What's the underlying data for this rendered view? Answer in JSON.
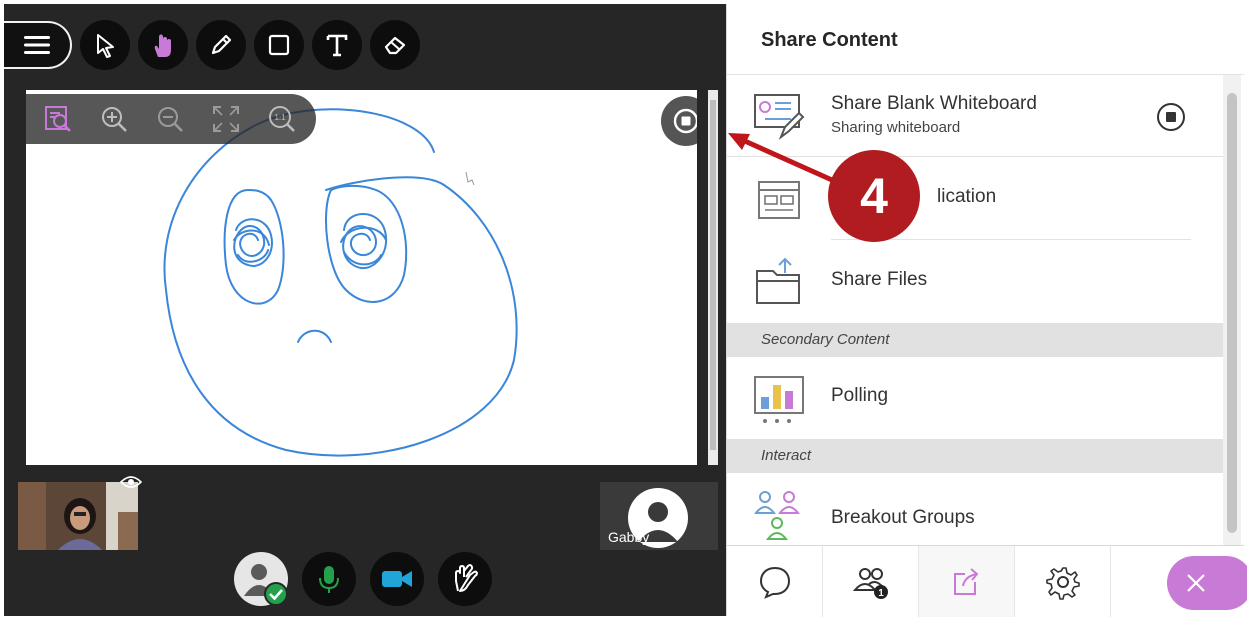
{
  "toolbar": {
    "tools": [
      {
        "name": "select-arrow-icon"
      },
      {
        "name": "pan-hand-icon",
        "active": true
      },
      {
        "name": "pencil-icon"
      },
      {
        "name": "rectangle-icon"
      },
      {
        "name": "text-icon"
      },
      {
        "name": "eraser-icon"
      }
    ]
  },
  "zoom": {
    "fit_label": "1:1"
  },
  "participant": {
    "name": "Gabby"
  },
  "panel": {
    "title": "Share Content",
    "items": [
      {
        "label": "Share Blank Whiteboard",
        "sub": "Sharing whiteboard"
      },
      {
        "label": "Share Application"
      },
      {
        "label": "Share Files"
      }
    ],
    "sections": [
      {
        "label": "Secondary Content"
      },
      {
        "label": "Interact"
      }
    ],
    "secondary_items": [
      {
        "label": "Polling"
      }
    ],
    "interact_items": [
      {
        "label": "Breakout Groups"
      }
    ],
    "visible_app_label": "lication"
  },
  "nav": {
    "attendee_count": "1"
  },
  "annotation": {
    "step": "4"
  },
  "colors": {
    "accent_purple": "#c87bd6",
    "step_red": "#b01c1f",
    "drawing_blue": "#3a86d8",
    "camera_blue": "#1fa5d8",
    "mic_green": "#23a04a"
  }
}
